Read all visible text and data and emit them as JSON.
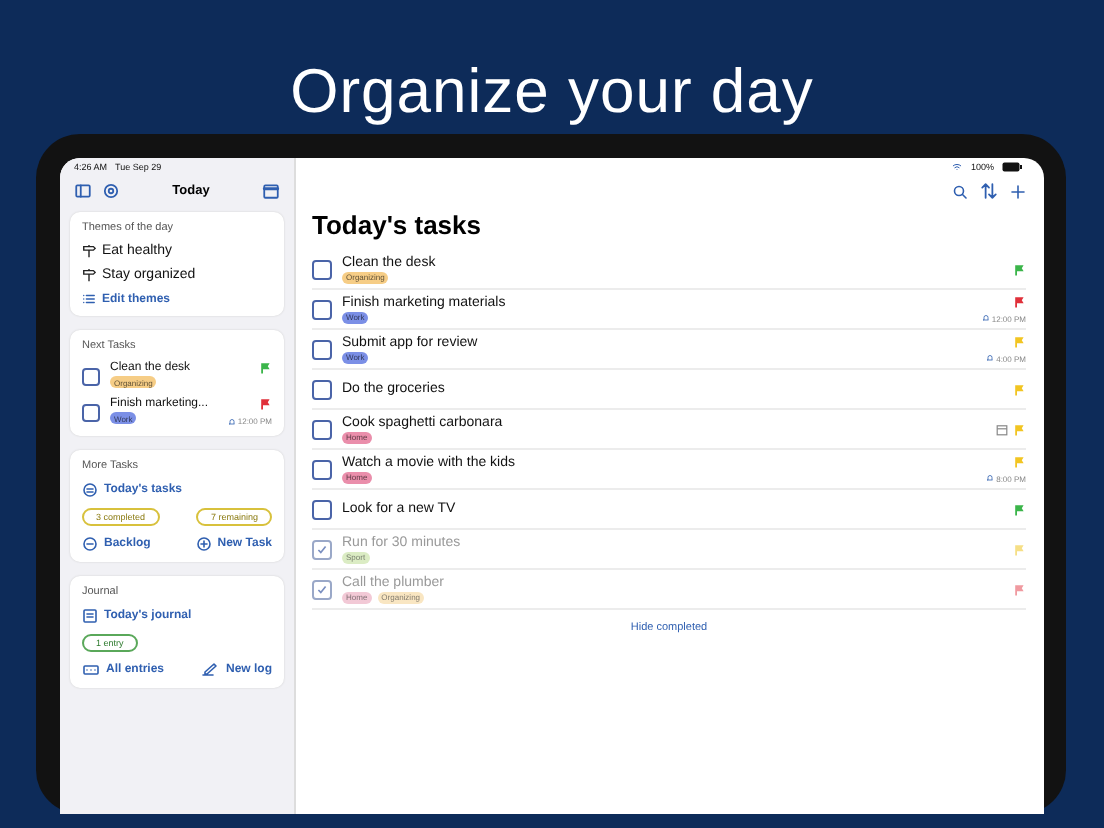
{
  "headline": "Organize your day",
  "status_bar": {
    "time": "4:26 AM",
    "date": "Tue Sep 29",
    "battery": "100%"
  },
  "sidebar": {
    "title": "Today",
    "themes": {
      "title": "Themes of the day",
      "items": [
        "Eat healthy",
        "Stay organized"
      ],
      "edit_link": "Edit themes"
    },
    "next_tasks": {
      "title": "Next Tasks",
      "items": [
        {
          "title": "Clean the desk",
          "checked": false,
          "tags": [
            {
              "label": "Organizing",
              "color": "#f6cd86"
            }
          ],
          "flag": {
            "color": "#3bb54a"
          }
        },
        {
          "title": "Finish marketing...",
          "checked": false,
          "tags": [
            {
              "label": "Work",
              "color": "#7b8fe6"
            }
          ],
          "flag": {
            "color": "#e0303a"
          },
          "time": "12:00 PM"
        }
      ]
    },
    "more_tasks": {
      "title": "More Tasks",
      "todays_tasks": "Today's tasks",
      "completed": "3 completed",
      "remaining": "7 remaining",
      "backlog": "Backlog",
      "new_task": "New Task"
    },
    "journal": {
      "title": "Journal",
      "todays_journal": "Today's journal",
      "entries": "1 entry",
      "all_entries": "All entries",
      "new_log": "New log"
    }
  },
  "main": {
    "title": "Today's tasks",
    "tasks": [
      {
        "title": "Clean the desk",
        "checked": false,
        "calendar": false,
        "tags": [
          {
            "label": "Organizing",
            "color": "#f6cd86"
          }
        ],
        "flag": {
          "color": "#3bb54a"
        }
      },
      {
        "title": "Finish marketing materials",
        "checked": false,
        "calendar": false,
        "tags": [
          {
            "label": "Work",
            "color": "#7b8fe6"
          }
        ],
        "flag": {
          "color": "#e0303a"
        },
        "time": "12:00 PM"
      },
      {
        "title": "Submit app for review",
        "checked": false,
        "calendar": false,
        "tags": [
          {
            "label": "Work",
            "color": "#7b8fe6"
          }
        ],
        "flag": {
          "color": "#f2c522"
        },
        "time": "4:00 PM"
      },
      {
        "title": "Do the groceries",
        "checked": false,
        "calendar": false,
        "flag": {
          "color": "#f2c522"
        }
      },
      {
        "title": "Cook spaghetti carbonara",
        "checked": false,
        "calendar": true,
        "tags": [
          {
            "label": "Home",
            "color": "#ea8eab"
          }
        ],
        "flag": {
          "color": "#f2c522"
        }
      },
      {
        "title": "Watch a movie with the kids",
        "checked": false,
        "calendar": false,
        "tags": [
          {
            "label": "Home",
            "color": "#ea8eab"
          }
        ],
        "flag": {
          "color": "#f2c522"
        },
        "time": "8:00 PM"
      },
      {
        "title": "Look for a new TV",
        "checked": false,
        "calendar": false,
        "flag": {
          "color": "#3bb54a"
        }
      },
      {
        "title": "Run for 30 minutes",
        "checked": true,
        "calendar": false,
        "tags": [
          {
            "label": "Sport",
            "color": "#d3e8b6"
          }
        ],
        "flag": {
          "color": "#f6df86"
        }
      },
      {
        "title": "Call the plumber",
        "checked": true,
        "calendar": false,
        "tags": [
          {
            "label": "Home",
            "color": "#f0bccc"
          },
          {
            "label": "Organizing",
            "color": "#f8e0b4"
          }
        ],
        "flag": {
          "color": "#f09aa0"
        }
      }
    ],
    "hide_completed": "Hide completed"
  }
}
